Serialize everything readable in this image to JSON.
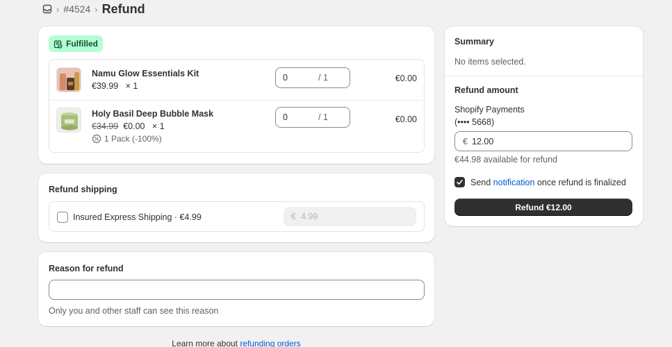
{
  "breadcrumb": {
    "order_number": "#4524",
    "separator": "›",
    "title": "Refund"
  },
  "fulfillment": {
    "status_badge": "Fulfilled",
    "items": [
      {
        "name": "Namu Glow Essentials Kit",
        "price": "€39.99",
        "quantity_text": "× 1",
        "refund_qty": "0",
        "max_qty": "/ 1",
        "line_total": "€0.00"
      },
      {
        "name": "Holy Basil Deep Bubble Mask",
        "original_price": "€34.99",
        "price": "€0.00",
        "quantity_text": "× 1",
        "discount": "1 Pack (-100%)",
        "refund_qty": "0",
        "max_qty": "/ 1",
        "line_total": "€0.00"
      }
    ]
  },
  "shipping": {
    "title": "Refund shipping",
    "label": "Insured Express Shipping · €4.99",
    "currency": "€",
    "amount_placeholder": "4.99"
  },
  "reason": {
    "title": "Reason for refund",
    "value": "",
    "help": "Only you and other staff can see this reason"
  },
  "footer": {
    "text": "Learn more about ",
    "link": "refunding orders"
  },
  "summary": {
    "title": "Summary",
    "text": "No items selected.",
    "refund_amount_title": "Refund amount",
    "payment_name": "Shopify Payments",
    "payment_card": "(•••• 5668)",
    "currency": "€",
    "amount": "12.00",
    "available": "€44.98 available for refund",
    "notify_prefix": "Send ",
    "notify_link": "notification",
    "notify_suffix": " once refund is finalized",
    "notify_checked": true,
    "button_label": "Refund €12.00"
  },
  "colors": {
    "badge_bg": "#b4fed2",
    "badge_text": "#0c5132",
    "link": "#005bd3",
    "primary_button": "#303030"
  }
}
